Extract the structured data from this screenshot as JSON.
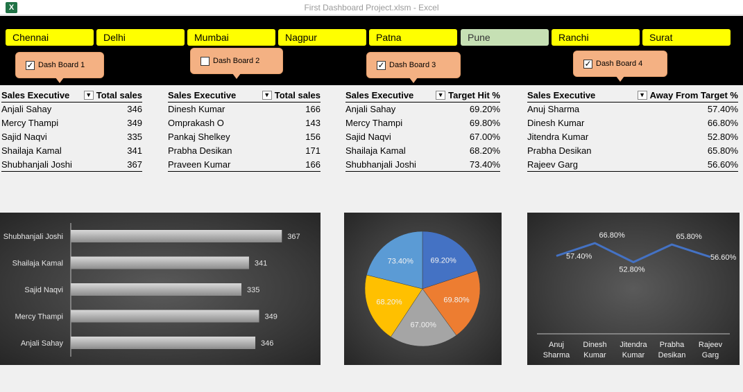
{
  "window": {
    "title": "First Dashboard Project.xlsm - Excel",
    "app_icon": "excel-icon"
  },
  "cities": [
    {
      "name": "Chennai",
      "selected": false
    },
    {
      "name": "Delhi",
      "selected": false
    },
    {
      "name": "Mumbai",
      "selected": false
    },
    {
      "name": "Nagpur",
      "selected": false
    },
    {
      "name": "Patna",
      "selected": false
    },
    {
      "name": "Pune",
      "selected": true
    },
    {
      "name": "Ranchi",
      "selected": false
    },
    {
      "name": "Surat",
      "selected": false
    }
  ],
  "dashboards": [
    {
      "label": "Dash Board 1",
      "checked": true
    },
    {
      "label": "Dash Board 2",
      "checked": false
    },
    {
      "label": "Dash Board 3",
      "checked": true
    },
    {
      "label": "Dash Board 4",
      "checked": true
    }
  ],
  "tables": [
    {
      "col1": "Sales Executive",
      "col2": "Total sales",
      "rows": [
        [
          "Anjali Sahay",
          "346"
        ],
        [
          "Mercy Thampi",
          "349"
        ],
        [
          "Sajid Naqvi",
          "335"
        ],
        [
          "Shailaja Kamal",
          "341"
        ],
        [
          "Shubhanjali Joshi",
          "367"
        ]
      ]
    },
    {
      "col1": "Sales Executive",
      "col2": "Total sales",
      "rows": [
        [
          "Dinesh Kumar",
          "166"
        ],
        [
          "Omprakash O",
          "143"
        ],
        [
          "Pankaj Shelkey",
          "156"
        ],
        [
          "Prabha Desikan",
          "171"
        ],
        [
          "Praveen Kumar",
          "166"
        ]
      ]
    },
    {
      "col1": "Sales Executive",
      "col2": "Target Hit %",
      "rows": [
        [
          "Anjali Sahay",
          "69.20%"
        ],
        [
          "Mercy Thampi",
          "69.80%"
        ],
        [
          "Sajid Naqvi",
          "67.00%"
        ],
        [
          "Shailaja Kamal",
          "68.20%"
        ],
        [
          "Shubhanjali Joshi",
          "73.40%"
        ]
      ]
    },
    {
      "col1": "Sales Executive",
      "col2": "Away From Target %",
      "rows": [
        [
          "Anuj Sharma",
          "57.40%"
        ],
        [
          "Dinesh Kumar",
          "66.80%"
        ],
        [
          "Jitendra Kumar",
          "52.80%"
        ],
        [
          "Prabha Desikan",
          "65.80%"
        ],
        [
          "Rajeev Garg",
          "56.60%"
        ]
      ]
    }
  ],
  "colors": {
    "banner": "#000000",
    "city": "#ffff00",
    "city_selected": "#c6e0b4",
    "callout": "#f4b183",
    "line": "#4472c4"
  },
  "chart_data": [
    {
      "type": "bar",
      "categories": [
        "Shubhanjali Joshi",
        "Shailaja Kamal",
        "Sajid Naqvi",
        "Mercy Thampi",
        "Anjali Sahay"
      ],
      "values": [
        367,
        341,
        335,
        349,
        346
      ],
      "xlim": [
        200,
        380
      ]
    },
    {
      "type": "pie",
      "categories": [
        "Anjali Sahay",
        "Mercy Thampi",
        "Sajid Naqvi",
        "Shailaja Kamal",
        "Shubhanjali Joshi"
      ],
      "values": [
        69.2,
        69.8,
        67.0,
        68.2,
        73.4
      ],
      "labels": [
        "69.20%",
        "69.80%",
        "67.00%",
        "68.20%",
        "73.40%"
      ],
      "colors": [
        "#4472c4",
        "#ed7d31",
        "#a5a5a5",
        "#ffc000",
        "#5b9bd5"
      ]
    },
    {
      "type": "line",
      "categories": [
        "Anuj Sharma",
        "Dinesh Kumar",
        "Jitendra Kumar",
        "Prabha Desikan",
        "Rajeev Garg"
      ],
      "values": [
        57.4,
        66.8,
        52.8,
        65.8,
        56.6
      ],
      "labels": [
        "57.40%",
        "66.80%",
        "52.80%",
        "65.80%",
        "56.60%"
      ],
      "ylim": [
        0,
        75
      ]
    }
  ]
}
